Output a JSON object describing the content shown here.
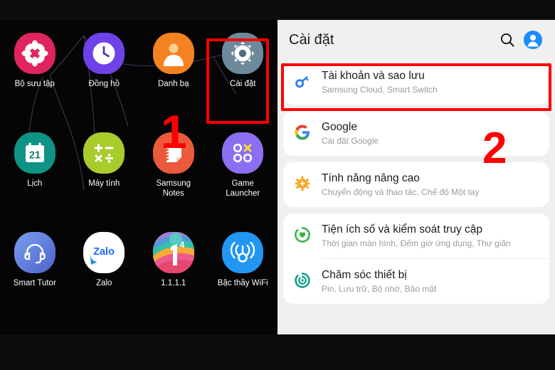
{
  "home": {
    "apps": [
      {
        "label": "Bộ sưu tập",
        "icon": "gallery-icon",
        "color": "#e0245e"
      },
      {
        "label": "Đồng hồ",
        "icon": "clock-icon",
        "color": "#6f42e8"
      },
      {
        "label": "Danh bạ",
        "icon": "contacts-icon",
        "color": "#f58220"
      },
      {
        "label": "Cài đặt",
        "icon": "settings-gear-icon",
        "color": "#6c8a9b"
      },
      {
        "label": "Lịch",
        "icon": "calendar-icon",
        "color": "#0f9384"
      },
      {
        "label": "Máy tính",
        "icon": "calculator-icon",
        "color": "#a8cc2b"
      },
      {
        "label": "Samsung\nNotes",
        "icon": "notes-icon",
        "color": "#ec5a3c"
      },
      {
        "label": "Game\nLauncher",
        "icon": "game-launcher-icon",
        "color": "#8b6ff0"
      },
      {
        "label": "Smart Tutor",
        "icon": "headset-icon",
        "color": "#5b7fe0"
      },
      {
        "label": "Zalo",
        "icon": "zalo-icon",
        "color": "#ffffff"
      },
      {
        "label": "1.1.1.1",
        "icon": "warp-icon",
        "color": "#f26d5b"
      },
      {
        "label": "Bậc thầy WiFi",
        "icon": "wifi-master-icon",
        "color": "#2196f3"
      }
    ],
    "calendar_day": "21",
    "zalo_text": "Zalo",
    "warp_number": "1",
    "warp_exponent": "4"
  },
  "settings": {
    "title": "Cài đặt",
    "search_icon": "search-icon",
    "account_icon": "account-avatar-icon",
    "groups": [
      {
        "items": [
          {
            "title": "Tài khoản và sao lưu",
            "subtitle": "Samsung Cloud, Smart Switch",
            "icon": "key-icon",
            "icon_color": "#2d7ff0"
          }
        ]
      },
      {
        "items": [
          {
            "title": "Google",
            "subtitle": "Cài đặt Google",
            "icon": "google-g-icon",
            "icon_color": "#4285f4"
          }
        ]
      },
      {
        "items": [
          {
            "title": "Tính năng nâng cao",
            "subtitle": "Chuyển động và thao tác, Chế độ Một tay",
            "icon": "advanced-features-icon",
            "icon_color": "#f5a623"
          }
        ]
      },
      {
        "items": [
          {
            "title": "Tiện ích số và kiểm soát truy cập",
            "subtitle": "Thời gian màn hình, Đếm giờ ứng dụng, Thư giãn",
            "icon": "digital-wellbeing-icon",
            "icon_color": "#3ab54a"
          },
          {
            "title": "Chăm sóc thiết bị",
            "subtitle": "Pin, Lưu trữ, Bộ nhớ, Bảo mật",
            "icon": "device-care-icon",
            "icon_color": "#12a08a"
          }
        ]
      }
    ]
  },
  "annotations": {
    "step_one": "1",
    "step_two": "2",
    "highlight_color": "#fd0000"
  }
}
